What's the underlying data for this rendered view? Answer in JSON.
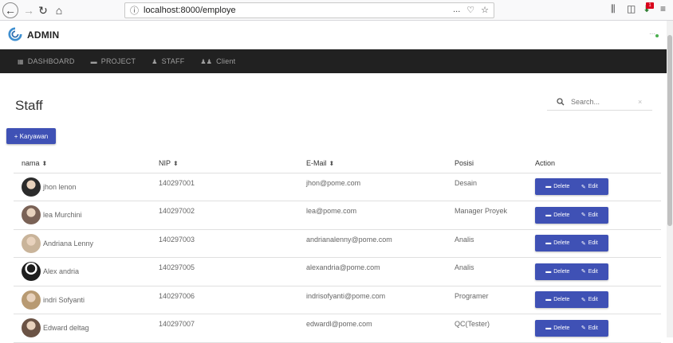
{
  "browser": {
    "url": "localhost:8000/employe",
    "actions_icon": "...",
    "badge": "1"
  },
  "header": {
    "brand": "ADMIN",
    "dots": "···"
  },
  "navbar": {
    "items": [
      {
        "label": "DASHBOARD",
        "icon": "grid-icon"
      },
      {
        "label": "PROJECT",
        "icon": "inbox-icon"
      },
      {
        "label": "STAFF",
        "icon": "person-icon"
      },
      {
        "label": "Client",
        "icon": "people-icon"
      }
    ]
  },
  "page": {
    "title": "Staff",
    "search_placeholder": "Search...",
    "search_clear": "×",
    "add_button": "+ Karyawan"
  },
  "table": {
    "headers": {
      "nama": "nama",
      "nip": "NIP",
      "email": "E-Mail",
      "posisi": "Posisi",
      "action": "Action"
    },
    "delete_label": "Delete",
    "edit_label": "Edit",
    "rows": [
      {
        "nama": "jhon lenon",
        "nip": "140297001",
        "email": "jhon@pome.com",
        "posisi": "Desain",
        "avatar_color": "#2b2b2b"
      },
      {
        "nama": "lea Murchini",
        "nip": "140297002",
        "email": "lea@pome.com",
        "posisi": "Manager Proyek",
        "avatar_color": "#7a6256"
      },
      {
        "nama": "Andriana Lenny",
        "nip": "140297003",
        "email": "andrianalenny@pome.com",
        "posisi": "Analis",
        "avatar_color": "#c9b49a"
      },
      {
        "nama": "Alex andria",
        "nip": "140297005",
        "email": "alexandria@pome.com",
        "posisi": "Analis",
        "avatar_color": "#1e1e1e"
      },
      {
        "nama": "indri Sofyanti",
        "nip": "140297006",
        "email": "indrisofyanti@pome.com",
        "posisi": "Programer",
        "avatar_color": "#b89a72"
      },
      {
        "nama": "Edward deltag",
        "nip": "140297007",
        "email": "edwardl@pome.com",
        "posisi": "QC(Tester)",
        "avatar_color": "#6b5345"
      }
    ]
  },
  "colors": {
    "primary": "#3f51b5",
    "navbar": "#212121"
  }
}
